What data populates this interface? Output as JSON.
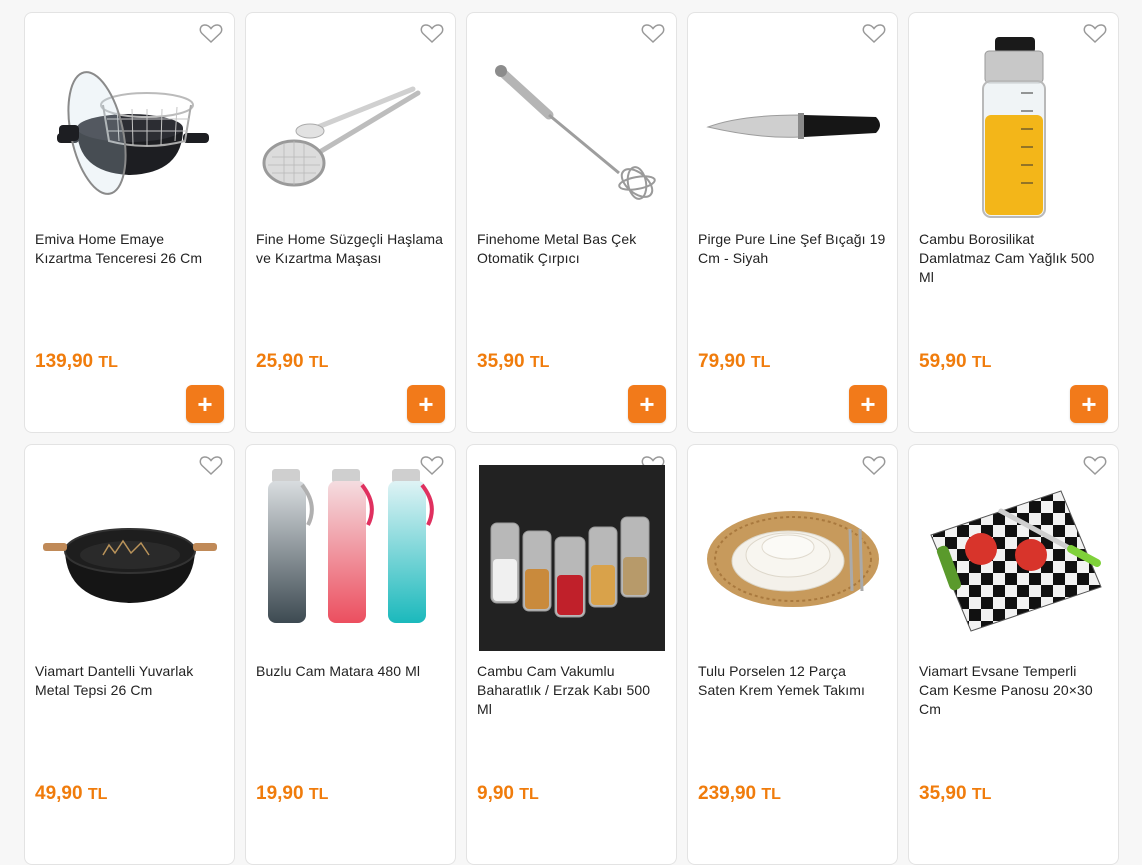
{
  "colors": {
    "accent": "#f27a1a",
    "price": "#f07c0c"
  },
  "products": [
    {
      "name": "Emiva Home Emaye Kızartma Tenceresi 26 Cm",
      "price": "139,90",
      "currency": "TL",
      "add_label": "+",
      "icon": "fryer-pot-icon"
    },
    {
      "name": "Fine Home Süzgeçli Haşlama ve Kızartma Maşası",
      "price": "25,90",
      "currency": "TL",
      "add_label": "+",
      "icon": "strainer-tongs-icon"
    },
    {
      "name": "Finehome Metal Bas Çek Otomatik Çırpıcı",
      "price": "35,90",
      "currency": "TL",
      "add_label": "+",
      "icon": "whisk-icon"
    },
    {
      "name": "Pirge Pure Line Şef Bıçağı 19 Cm - Siyah",
      "price": "79,90",
      "currency": "TL",
      "add_label": "+",
      "icon": "chef-knife-icon"
    },
    {
      "name": "Cambu Borosilikat Damlatmaz Cam Yağlık 500 Ml",
      "price": "59,90",
      "currency": "TL",
      "add_label": "+",
      "icon": "oil-bottle-icon"
    },
    {
      "name": "Viamart Dantelli Yuvarlak Metal Tepsi 26 Cm",
      "price": "49,90",
      "currency": "TL",
      "icon": "metal-tray-icon"
    },
    {
      "name": "Buzlu Cam Matara 480 Ml",
      "price": "19,90",
      "currency": "TL",
      "icon": "water-bottles-icon"
    },
    {
      "name": "Cambu Cam Vakumlu Baharatlık / Erzak Kabı 500 Ml",
      "price": "9,90",
      "currency": "TL",
      "icon": "spice-jars-icon"
    },
    {
      "name": "Tulu Porselen 12 Parça Saten Krem Yemek Takımı",
      "price": "239,90",
      "currency": "TL",
      "icon": "dinner-set-icon"
    },
    {
      "name": "Viamart Evsane Temperli Cam Kesme Panosu 20×30 Cm",
      "price": "35,90",
      "currency": "TL",
      "icon": "cutting-board-icon"
    }
  ]
}
